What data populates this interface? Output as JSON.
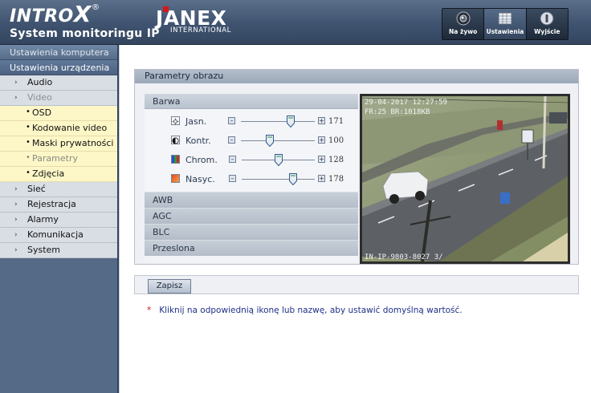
{
  "header": {
    "brand_main": "INTRO",
    "brand_x": "X",
    "brand_reg": "®",
    "brand_sub": "System monitoringu IP",
    "janex_name": "JANEX",
    "janex_intl": "INTERNATIONAL",
    "nav": [
      {
        "label": "Na żywo",
        "icon": "camera-icon"
      },
      {
        "label": "Ustawienia",
        "icon": "settings-grid-icon"
      },
      {
        "label": "Wyjście",
        "icon": "exit-icon"
      }
    ]
  },
  "sidebar": {
    "head_computer": "Ustawienia komputera",
    "head_device": "Ustawienia urządzenia",
    "items": {
      "audio": "Audio",
      "video": "Video",
      "siec": "Sieć",
      "rejestracja": "Rejestracja",
      "alarmy": "Alarmy",
      "komunikacja": "Komunikacja",
      "system": "System"
    },
    "video_sub": {
      "osd": "OSD",
      "kodowanie": "Kodowanie video",
      "maski": "Maski prywatności",
      "parametry": "Parametry",
      "zdjecia": "Zdjęcia"
    }
  },
  "panel": {
    "title": "Parametry obrazu",
    "barwa": "Barwa",
    "sliders": [
      {
        "label": "Jasn.",
        "value": "171",
        "icon": "brightness-icon",
        "level": 0.67
      },
      {
        "label": "Kontr.",
        "value": "100",
        "icon": "contrast-icon",
        "level": 0.39
      },
      {
        "label": "Chrom.",
        "value": "128",
        "icon": "chroma-icon",
        "level": 0.5
      },
      {
        "label": "Nasyc.",
        "value": "178",
        "icon": "saturation-icon",
        "level": 0.7
      }
    ],
    "sections": {
      "awb": "AWB",
      "agc": "AGC",
      "blc": "BLC",
      "przeslona": "Przeslona"
    },
    "video_top": "29-04-2017 12:27:59",
    "video_top2": "FR:25 BR:1018KB",
    "video_bottom": "IN-IP-9803-8027 3/"
  },
  "save_label": "Zapisz",
  "note": {
    "star": "*",
    "text": "Kliknij na odpowiednią ikonę lub nazwę, aby ustawić domyślną wartość."
  },
  "colors": {
    "accent": "#3f5370",
    "sidebar": "#536985",
    "note": "#1f2f86",
    "star": "#d0141c"
  }
}
